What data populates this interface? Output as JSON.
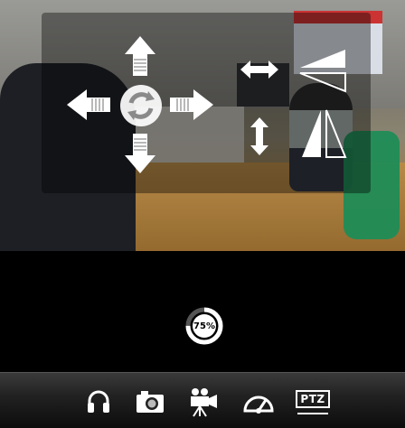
{
  "video": {
    "overlay": {
      "pan_tilt": {
        "up_icon": "arrow-up-icon",
        "down_icon": "arrow-down-icon",
        "left_icon": "arrow-left-icon",
        "right_icon": "arrow-right-icon",
        "center_icon": "refresh-icon"
      },
      "flip": {
        "horizontal_icon": "double-arrow-horizontal-icon",
        "vertical_icon": "double-arrow-vertical-icon",
        "mirror_icon": "mirror-horizontal-icon",
        "flip_icon": "flip-vertical-icon"
      }
    }
  },
  "loading": {
    "percent": 75,
    "label": "75%"
  },
  "toolbar": {
    "items": [
      {
        "name": "audio",
        "icon": "headphones-icon"
      },
      {
        "name": "snapshot",
        "icon": "camera-icon"
      },
      {
        "name": "record",
        "icon": "video-camera-icon"
      },
      {
        "name": "speed",
        "icon": "gauge-icon"
      },
      {
        "name": "ptz",
        "icon": "ptz-icon",
        "label": "PTZ"
      }
    ]
  }
}
